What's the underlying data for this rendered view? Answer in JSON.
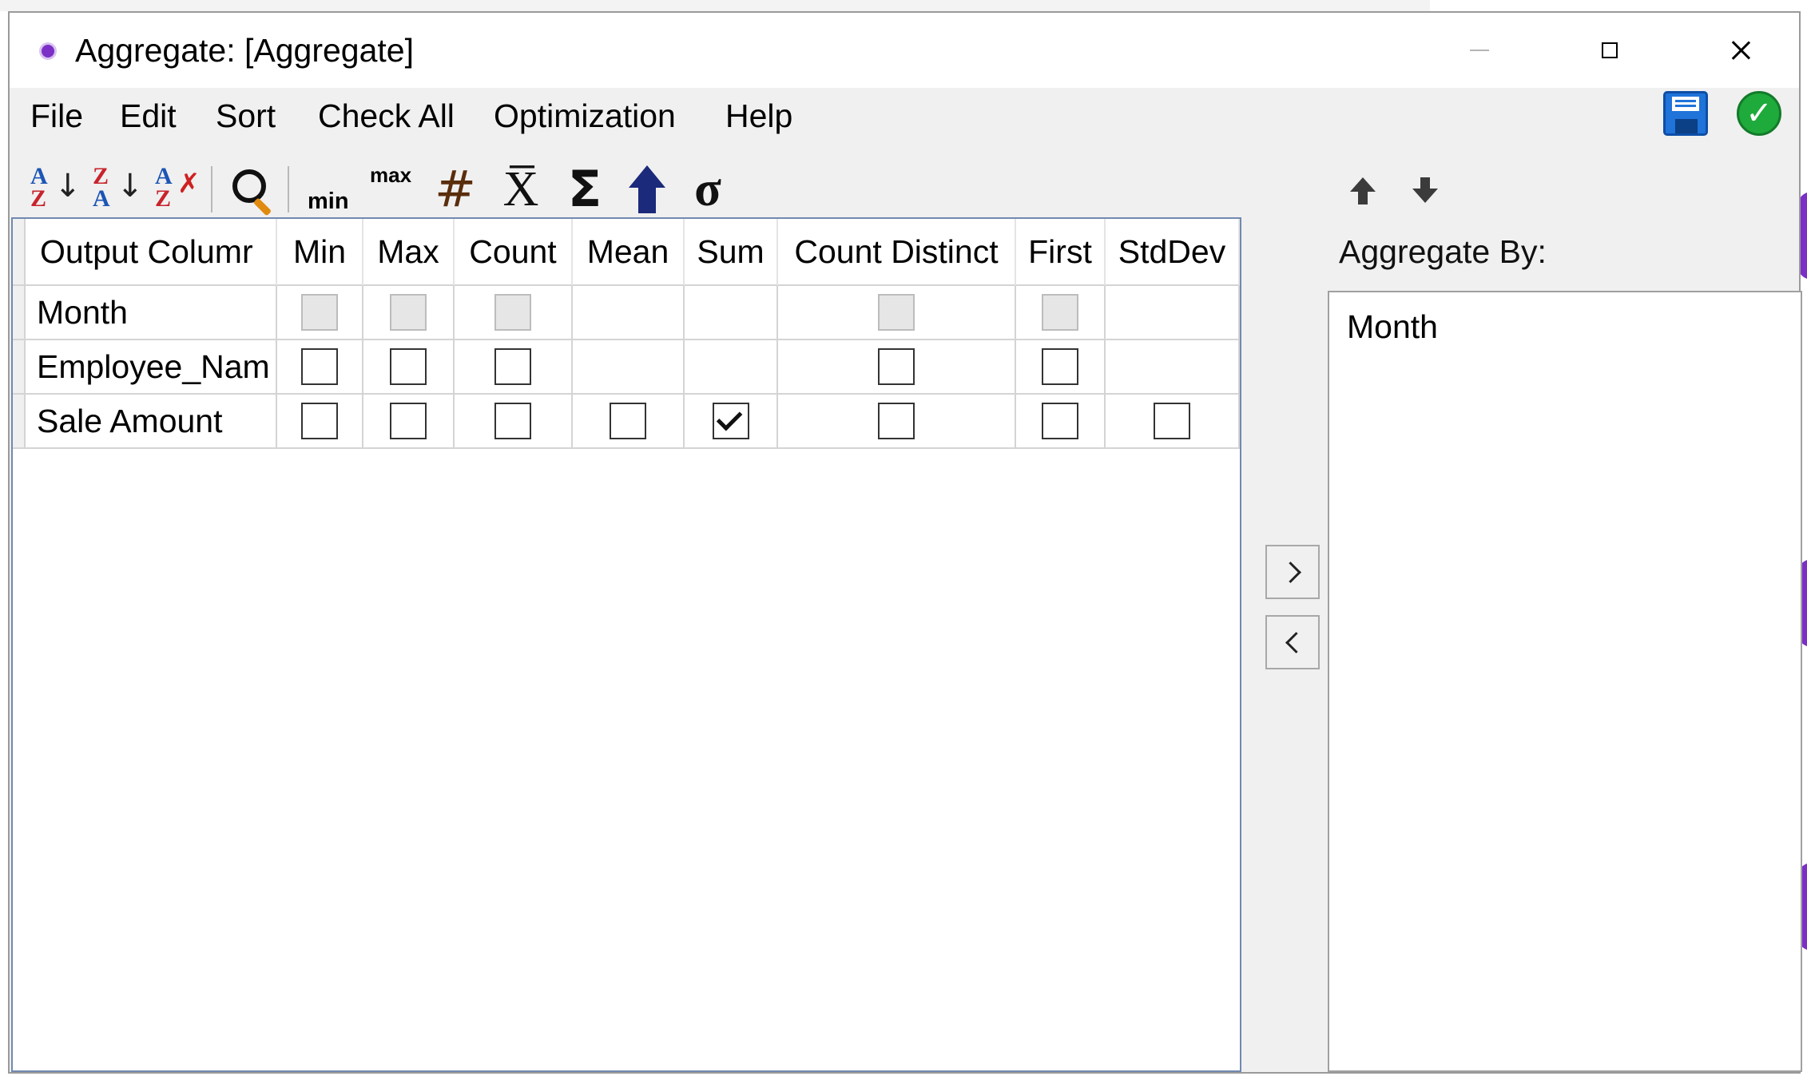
{
  "window": {
    "title": "Aggregate: [Aggregate]"
  },
  "menu": {
    "items": [
      "File",
      "Edit",
      "Sort",
      "Check All",
      "Optimization",
      "Help"
    ]
  },
  "toolbar": {
    "sort_ascending": {
      "top": "A",
      "bottom": "Z"
    },
    "sort_descending": {
      "top": "Z",
      "bottom": "A"
    },
    "clear_sort": {
      "top": "A",
      "bottom": "Z"
    },
    "min_label": "min",
    "max_label": "max",
    "count_symbol": "#",
    "mean_symbol": "X̅",
    "sum_symbol": "Σ",
    "stddev_symbol": "σ"
  },
  "grid": {
    "columns": [
      "Output Columr",
      "Min",
      "Max",
      "Count",
      "Mean",
      "Sum",
      "Count Distinct",
      "First",
      "StdDev"
    ],
    "rows": [
      {
        "name": "Month",
        "checks": [
          "disabled",
          "disabled",
          "disabled",
          "none",
          "none",
          "disabled",
          "disabled",
          "none"
        ]
      },
      {
        "name": "Employee_Nam",
        "checks": [
          "unchecked",
          "unchecked",
          "unchecked",
          "none",
          "none",
          "unchecked",
          "unchecked",
          "none"
        ]
      },
      {
        "name": "Sale Amount",
        "checks": [
          "unchecked",
          "unchecked",
          "unchecked",
          "unchecked",
          "checked",
          "unchecked",
          "unchecked",
          "unchecked"
        ]
      }
    ]
  },
  "aggregate_by": {
    "label": "Aggregate By:",
    "items": [
      "Month"
    ]
  },
  "colors": {
    "accent_border": "#7189b0",
    "save_icon": "#1f73d9",
    "ok_icon": "#1faa3c"
  }
}
